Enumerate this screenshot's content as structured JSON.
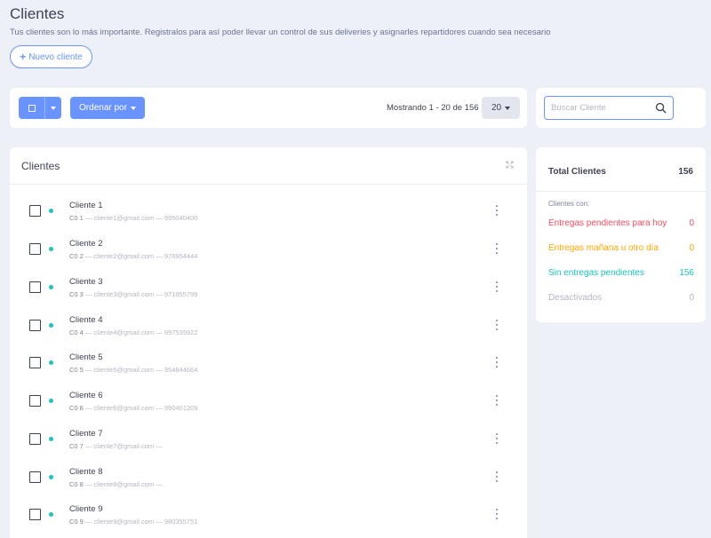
{
  "header": {
    "title": "Clientes",
    "subtitle": "Tus clientes son lo más importante. Registralos para así poder llevar un control de sus deliveries y asignarles repartidores cuando sea necesario",
    "new_button_label": "Nuevo cliente"
  },
  "toolbar": {
    "order_label": "Ordenar por",
    "showing_text": "Mostrando 1 - 20 de 156",
    "page_size": "20"
  },
  "search": {
    "placeholder": "Buscar Cliente"
  },
  "clients": {
    "title": "Clientes",
    "rows": [
      {
        "name": "Cliente 1",
        "code": "C0 1",
        "email": "— cliente1@gmail.com",
        "phone": "— 995040400"
      },
      {
        "name": "Cliente 2",
        "code": "C0 2",
        "email": "— cliente2@gmail.com",
        "phone": "— 976954444"
      },
      {
        "name": "Cliente 3",
        "code": "C0 3",
        "email": "— cliente3@gmail.com",
        "phone": "— 971855799"
      },
      {
        "name": "Cliente 4",
        "code": "C0 4",
        "email": "— cliente4@gmail.com",
        "phone": "— 997535922"
      },
      {
        "name": "Cliente 5",
        "code": "C0 5",
        "email": "— cliente5@gmail.com",
        "phone": "— 954844664"
      },
      {
        "name": "Cliente 6",
        "code": "C0 6",
        "email": "— cliente6@gmail.com",
        "phone": "— 990401209"
      },
      {
        "name": "Cliente 7",
        "code": "C0 7",
        "email": "— cliente7@gmail.com",
        "phone": "—"
      },
      {
        "name": "Cliente 8",
        "code": "C0 8",
        "email": "— cliente8@gmail.com",
        "phone": "—"
      },
      {
        "name": "Cliente 9",
        "code": "C0 9",
        "email": "— cliente9@gmail.com",
        "phone": "— 980355751"
      }
    ]
  },
  "stats": {
    "total_label": "Total Clientes",
    "total_value": "156",
    "subtitle": "Clientes con:",
    "items": [
      {
        "label": "Entregas pendientes para hoy",
        "value": "0",
        "color": "#f64e60"
      },
      {
        "label": "Entregas mañana u otro día",
        "value": "0",
        "color": "#ffa800"
      },
      {
        "label": "Sin entregas pendientes",
        "value": "156",
        "color": "#1bc5bd"
      },
      {
        "label": "Desactivados",
        "value": "0",
        "color": "#b5b5c3"
      }
    ]
  },
  "colors": {
    "primary": "#6993ff",
    "status_dot": "#1bc5bd"
  },
  "icons": {
    "plus": "plus-icon",
    "search": "search-icon",
    "expand": "expand-icon",
    "row_menu": "more-vertical-icon"
  }
}
